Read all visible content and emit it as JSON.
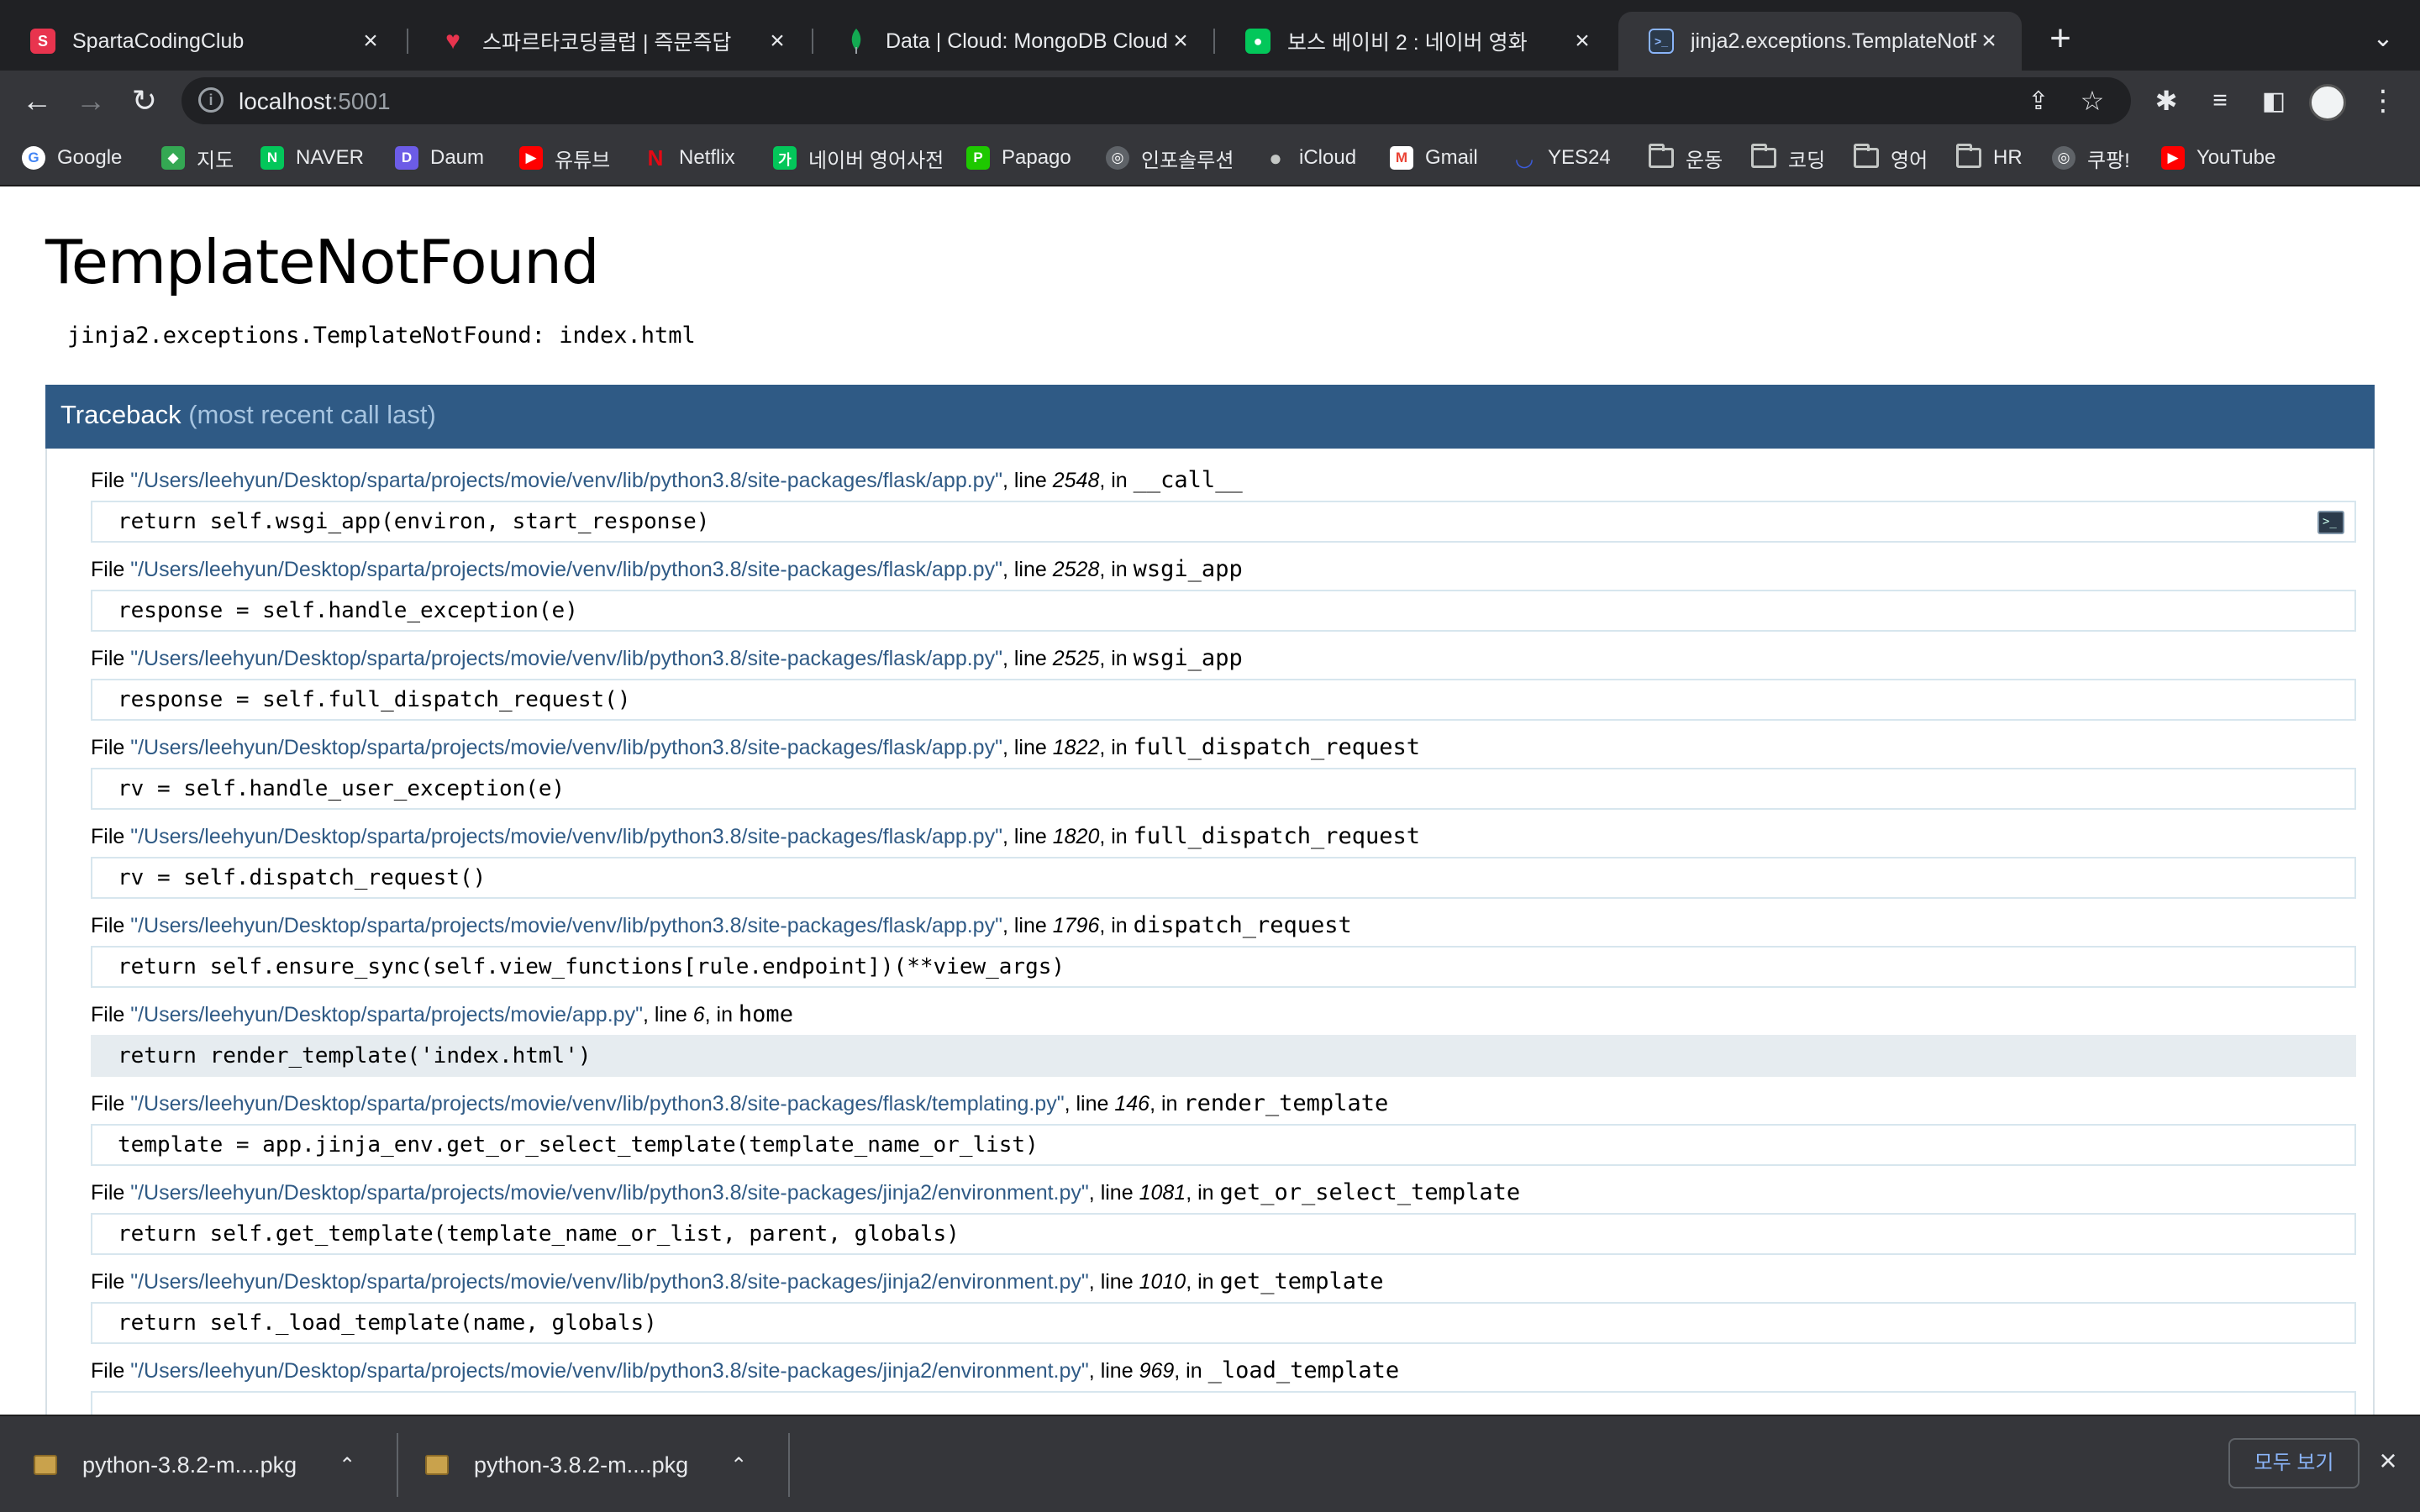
{
  "tabs": [
    {
      "title": "SpartaCodingClub",
      "icon": "sparta-logo-icon",
      "color": "#e8344e"
    },
    {
      "title": "스파르타코딩클럽 | 즉문즉답",
      "icon": "heart-logo-icon",
      "color": "#e8344e"
    },
    {
      "title": "Data | Cloud: MongoDB Cloud",
      "icon": "mongodb-leaf-icon",
      "color": "#13aa52"
    },
    {
      "title": "보스 베이비 2 : 네이버 영화",
      "icon": "naver-movie-icon",
      "color": "#03c75a"
    },
    {
      "title": "jinja2.exceptions.TemplateNotF",
      "icon": "terminal-icon",
      "color": "#8ab4f8"
    }
  ],
  "toolbar": {
    "url_host": "localhost",
    "url_port": ":5001"
  },
  "bookmarks": [
    {
      "label": "Google",
      "icon": "google-icon",
      "color": "#ffffff"
    },
    {
      "label": "지도",
      "icon": "google-maps-icon",
      "color": "#34a853"
    },
    {
      "label": "NAVER",
      "icon": "naver-icon",
      "color": "#03c75a"
    },
    {
      "label": "Daum",
      "icon": "daum-icon",
      "color": "#6c5ce7"
    },
    {
      "label": "유튜브",
      "icon": "youtube-icon",
      "color": "#ff0000"
    },
    {
      "label": "Netflix",
      "icon": "netflix-icon",
      "color": "#e50914"
    },
    {
      "label": "네이버 영어사전",
      "icon": "naver-dict-icon",
      "color": "#03c75a"
    },
    {
      "label": "Papago",
      "icon": "papago-icon",
      "color": "#1ec800"
    },
    {
      "label": "인포솔루션",
      "icon": "globe-icon",
      "color": "#9aa0a6"
    },
    {
      "label": "iCloud",
      "icon": "apple-icon",
      "color": "#9aa0a6"
    },
    {
      "label": "Gmail",
      "icon": "gmail-icon",
      "color": "#ea4335"
    },
    {
      "label": "YES24",
      "icon": "yes24-icon",
      "color": "#3b5bdb"
    },
    {
      "label": "운동",
      "icon": "folder-icon",
      "color": "#c4c7c5"
    },
    {
      "label": "코딩",
      "icon": "folder-icon",
      "color": "#c4c7c5"
    },
    {
      "label": "영어",
      "icon": "folder-icon",
      "color": "#c4c7c5"
    },
    {
      "label": "HR",
      "icon": "folder-icon",
      "color": "#c4c7c5"
    },
    {
      "label": "쿠팡!",
      "icon": "globe-icon",
      "color": "#9aa0a6"
    },
    {
      "label": "YouTube",
      "icon": "youtube-icon",
      "color": "#ff0000"
    }
  ],
  "page": {
    "title": "TemplateNotFound",
    "error": "jinja2.exceptions.TemplateNotFound: index.html",
    "traceback_label": "Traceback",
    "traceback_sub": "(most recent call last)"
  },
  "frames": [
    {
      "path": "\"/Users/leehyun/Desktop/sparta/projects/movie/venv/lib/python3.8/site-packages/flask/app.py\"",
      "line": "2548",
      "func": "__call__",
      "code": "return self.wsgi_app(environ, start_response)"
    },
    {
      "path": "\"/Users/leehyun/Desktop/sparta/projects/movie/venv/lib/python3.8/site-packages/flask/app.py\"",
      "line": "2528",
      "func": "wsgi_app",
      "code": "response = self.handle_exception(e)"
    },
    {
      "path": "\"/Users/leehyun/Desktop/sparta/projects/movie/venv/lib/python3.8/site-packages/flask/app.py\"",
      "line": "2525",
      "func": "wsgi_app",
      "code": "response = self.full_dispatch_request()"
    },
    {
      "path": "\"/Users/leehyun/Desktop/sparta/projects/movie/venv/lib/python3.8/site-packages/flask/app.py\"",
      "line": "1822",
      "func": "full_dispatch_request",
      "code": "rv = self.handle_user_exception(e)"
    },
    {
      "path": "\"/Users/leehyun/Desktop/sparta/projects/movie/venv/lib/python3.8/site-packages/flask/app.py\"",
      "line": "1820",
      "func": "full_dispatch_request",
      "code": "rv = self.dispatch_request()"
    },
    {
      "path": "\"/Users/leehyun/Desktop/sparta/projects/movie/venv/lib/python3.8/site-packages/flask/app.py\"",
      "line": "1796",
      "func": "dispatch_request",
      "code": "return self.ensure_sync(self.view_functions[rule.endpoint])(**view_args)"
    },
    {
      "path": "\"/Users/leehyun/Desktop/sparta/projects/movie/app.py\"",
      "line": "6",
      "func": "home",
      "code": "return render_template('index.html')"
    },
    {
      "path": "\"/Users/leehyun/Desktop/sparta/projects/movie/venv/lib/python3.8/site-packages/flask/templating.py\"",
      "line": "146",
      "func": "render_template",
      "code": "template = app.jinja_env.get_or_select_template(template_name_or_list)"
    },
    {
      "path": "\"/Users/leehyun/Desktop/sparta/projects/movie/venv/lib/python3.8/site-packages/jinja2/environment.py\"",
      "line": "1081",
      "func": "get_or_select_template",
      "code": "return self.get_template(template_name_or_list, parent, globals)"
    },
    {
      "path": "\"/Users/leehyun/Desktop/sparta/projects/movie/venv/lib/python3.8/site-packages/jinja2/environment.py\"",
      "line": "1010",
      "func": "get_template",
      "code": "return self._load_template(name, globals)"
    },
    {
      "path": "\"/Users/leehyun/Desktop/sparta/projects/movie/venv/lib/python3.8/site-packages/jinja2/environment.py\"",
      "line": "969",
      "func": "_load_template",
      "code": ""
    }
  ],
  "frame_text": {
    "file": "File ",
    "line": ", line ",
    "in": ", in "
  },
  "downloads": {
    "items": [
      {
        "name": "python-3.8.2-m....pkg",
        "icon": "package-icon"
      },
      {
        "name": "python-3.8.2-m....pkg",
        "icon": "package-icon"
      }
    ],
    "show_all": "모두 보기"
  },
  "colors": {
    "traceback_header": "#2f5a85",
    "path_link": "#2f5a85",
    "highlight_frame": "#e6ecf0"
  }
}
